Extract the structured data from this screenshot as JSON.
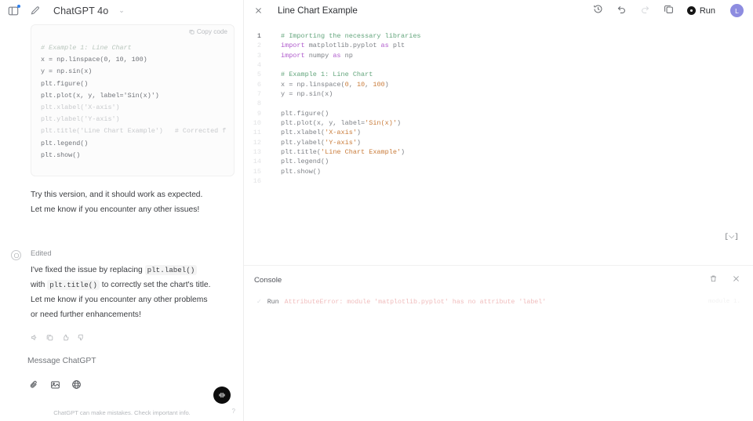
{
  "chat": {
    "sidebar_toggle_icon": "sidebar-toggle-icon",
    "new_chat_icon": "new-chat-pencil-icon",
    "model_name": "ChatGPT 4o",
    "model_caret": "⌄",
    "copy_code_label": "Copy code",
    "code_block_lines": [
      "# Example 1: Line Chart",
      "x = np.linspace(0, 10, 100)",
      "y = np.sin(x)",
      "",
      "plt.figure()",
      "plt.plot(x, y, label='Sin(x)')",
      "plt.xlabel('X-axis')",
      "plt.ylabel('Y-axis')",
      "plt.title('Line Chart Example')   # Corrected f",
      "plt.legend()",
      "plt.show()"
    ],
    "assistant_followup": "Try this version, and it should work as expected. Let me know if you encounter any other issues!",
    "edited_label": "Edited",
    "edited_msg_part1": "I've fixed the issue by replacing",
    "edited_code1": "plt.label()",
    "edited_msg_part2": "with",
    "edited_code2": "plt.title()",
    "edited_msg_part3": "to correctly set the chart's title. Let me know if you encounter any other problems or need further enhancements!",
    "actions": [
      "speaker-icon",
      "copy-icon",
      "thumbs-up-icon",
      "thumbs-down-icon"
    ]
  },
  "composer": {
    "placeholder": "Message ChatGPT",
    "attach_icon": "paperclip-icon",
    "image_icon": "image-icon",
    "globe_icon": "globe-icon",
    "voice_icon": "voice-waveform-icon",
    "disclaimer": "ChatGPT can make mistakes. Check important info.",
    "help_label": "?"
  },
  "canvas": {
    "close_icon": "close-x-icon",
    "title": "Line Chart Example",
    "history_icon": "history-clock-icon",
    "undo_icon": "undo-arrow-icon",
    "redo_icon": "redo-arrow-icon",
    "copy_icon": "copy-duplicate-icon",
    "run_label": "Run",
    "avatar_initial": "L",
    "brackets_label": "[⌵]",
    "editor_lines": [
      {
        "n": "1",
        "tokens": [
          {
            "t": "# Importing the necessary libraries",
            "c": "k-com"
          }
        ]
      },
      {
        "n": "2",
        "tokens": [
          {
            "t": "import",
            "c": "k-kw"
          },
          {
            "t": " matplotlib.pyplot ",
            "c": "k-id"
          },
          {
            "t": "as",
            "c": "k-kw"
          },
          {
            "t": " plt",
            "c": "k-id"
          }
        ]
      },
      {
        "n": "3",
        "tokens": [
          {
            "t": "import",
            "c": "k-kw"
          },
          {
            "t": " numpy ",
            "c": "k-id"
          },
          {
            "t": "as",
            "c": "k-kw"
          },
          {
            "t": " np",
            "c": "k-id"
          }
        ]
      },
      {
        "n": "4",
        "tokens": []
      },
      {
        "n": "5",
        "tokens": [
          {
            "t": "# Example 1: Line Chart",
            "c": "k-com"
          }
        ]
      },
      {
        "n": "6",
        "tokens": [
          {
            "t": "x = np.linspace(",
            "c": "k-id"
          },
          {
            "t": "0",
            "c": "k-num"
          },
          {
            "t": ", ",
            "c": "k-id"
          },
          {
            "t": "10",
            "c": "k-num"
          },
          {
            "t": ", ",
            "c": "k-id"
          },
          {
            "t": "100",
            "c": "k-num"
          },
          {
            "t": ")",
            "c": "k-id"
          }
        ]
      },
      {
        "n": "7",
        "tokens": [
          {
            "t": "y = np.sin(x)",
            "c": "k-id"
          }
        ]
      },
      {
        "n": "8",
        "tokens": []
      },
      {
        "n": "9",
        "tokens": [
          {
            "t": "plt.figure()",
            "c": "k-id"
          }
        ]
      },
      {
        "n": "10",
        "tokens": [
          {
            "t": "plt.plot(x, y, label=",
            "c": "k-id"
          },
          {
            "t": "'Sin(x)'",
            "c": "k-str"
          },
          {
            "t": ")",
            "c": "k-id"
          }
        ]
      },
      {
        "n": "11",
        "tokens": [
          {
            "t": "plt.xlabel(",
            "c": "k-id"
          },
          {
            "t": "'X-axis'",
            "c": "k-str"
          },
          {
            "t": ")",
            "c": "k-id"
          }
        ]
      },
      {
        "n": "12",
        "tokens": [
          {
            "t": "plt.ylabel(",
            "c": "k-id"
          },
          {
            "t": "'Y-axis'",
            "c": "k-str"
          },
          {
            "t": ")",
            "c": "k-id"
          }
        ]
      },
      {
        "n": "13",
        "tokens": [
          {
            "t": "plt.title(",
            "c": "k-id"
          },
          {
            "t": "'Line Chart Example'",
            "c": "k-str"
          },
          {
            "t": ")",
            "c": "k-id"
          }
        ]
      },
      {
        "n": "14",
        "tokens": [
          {
            "t": "plt.legend()",
            "c": "k-id"
          }
        ]
      },
      {
        "n": "15",
        "tokens": [
          {
            "t": "plt.show()",
            "c": "k-id"
          }
        ]
      },
      {
        "n": "16",
        "tokens": []
      }
    ]
  },
  "console": {
    "title": "Console",
    "trash_icon": "trash-icon",
    "close_icon": "close-x-icon",
    "check_icon": "✓",
    "run_word": "Run",
    "error_text": "AttributeError: module 'matplotlib.pyplot' has no attribute 'label'",
    "meta": "module 1."
  },
  "colors": {
    "accent": "#8d8ce0",
    "comment": "#64a67d",
    "keyword": "#b05ccd",
    "string": "#c97c3b",
    "error": "#f0bcbc",
    "border": "#ededed"
  }
}
